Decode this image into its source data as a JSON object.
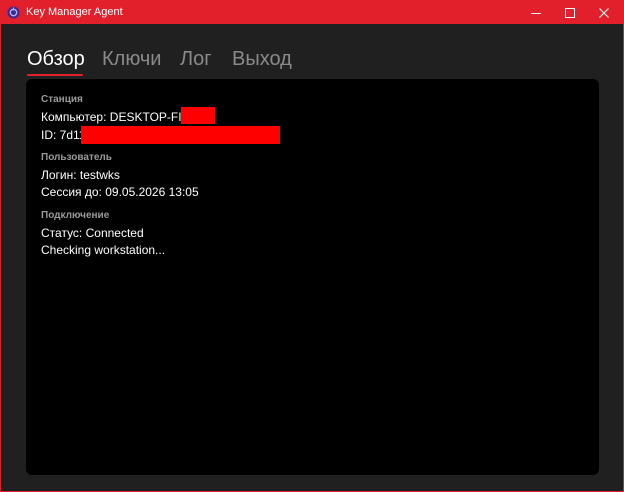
{
  "window": {
    "title": "Key Manager Agent",
    "accent_color": "#e2202b",
    "icons": {
      "app": "app-logo-icon",
      "minimize": "minimize-icon",
      "maximize": "maximize-icon",
      "close": "close-icon"
    }
  },
  "tabs": [
    {
      "label": "Обзор",
      "active": true
    },
    {
      "label": "Ключи",
      "active": false
    },
    {
      "label": "Лог",
      "active": false
    },
    {
      "label": "Выход",
      "active": false
    }
  ],
  "overview": {
    "station": {
      "heading": "Станция",
      "computer": "Компьютер: DESKTOP-FID",
      "id": "ID: 7d11"
    },
    "user": {
      "heading": "Пользователь",
      "login": "Логин: testwks",
      "session": "Сессия до: 09.05.2026 13:05"
    },
    "connection": {
      "heading": "Подключение",
      "status": "Статус: Connected",
      "message": "Checking workstation..."
    }
  },
  "redaction_color": "#ff0000"
}
